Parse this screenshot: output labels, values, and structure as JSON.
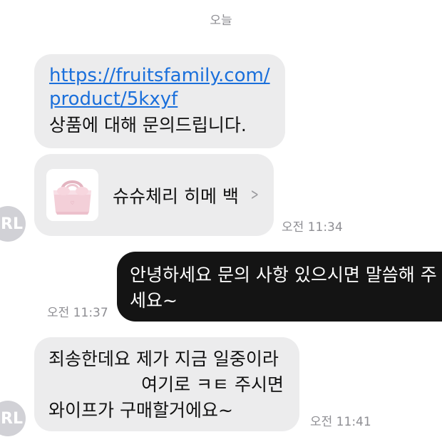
{
  "header": {
    "date_label": "오늘"
  },
  "messages": [
    {
      "link_line1": "https://fruitsfamily.com/",
      "link_line2": "product/5kxyf",
      "text": "상품에 대해 문의드립니다."
    },
    {
      "product_name": "슈슈체리 히메 백",
      "chevron_icon": "chevron-right-icon",
      "time": "오전 11:34",
      "avatar_text": "RL"
    },
    {
      "text": "안녕하세요 문의 사항 있으시면 말씀해 주\n세요~",
      "time": "오전 11:37"
    },
    {
      "line1": "죄송한데요 제가 지금 일중이라",
      "line2": "여기로 ㅋㅌ 주시면",
      "line3": "와이프가 구매할거에요~",
      "time": "오전 11:41",
      "avatar_text": "RL"
    }
  ],
  "colors": {
    "incoming_bubble": "#ececed",
    "outgoing_bubble": "#141414",
    "link": "#1a6fdb",
    "timestamp": "#8e8e93",
    "avatar": "#d1d1d6"
  }
}
